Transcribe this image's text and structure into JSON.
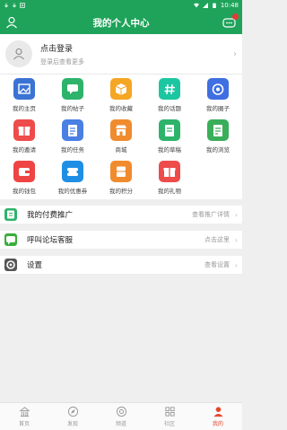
{
  "status_bar": {
    "time": "10:48"
  },
  "header": {
    "title": "我的个人中心"
  },
  "login": {
    "title": "点击登录",
    "subtitle": "登录后查看更多"
  },
  "grid": [
    {
      "label": "我的主页",
      "color": "#3b73d4",
      "icon": "image-icon"
    },
    {
      "label": "我的帖子",
      "color": "#2eb36b",
      "icon": "chat-icon"
    },
    {
      "label": "我的收藏",
      "color": "#f5a623",
      "icon": "cube-icon"
    },
    {
      "label": "我的话题",
      "color": "#1cc6a0",
      "icon": "hashtag-icon"
    },
    {
      "label": "我的圈子",
      "color": "#3f6fe0",
      "icon": "circle-icon"
    },
    {
      "label": "我的邀请",
      "color": "#ee4b4b",
      "icon": "gift-icon"
    },
    {
      "label": "我的任务",
      "color": "#4a7fe3",
      "icon": "task-icon"
    },
    {
      "label": "商城",
      "color": "#f08b2e",
      "icon": "shop-icon"
    },
    {
      "label": "我的草稿",
      "color": "#2eb36b",
      "icon": "draft-icon"
    },
    {
      "label": "我的浏览",
      "color": "#3aae5a",
      "icon": "history-icon"
    },
    {
      "label": "我的钱包",
      "color": "#ee4444",
      "icon": "wallet-icon"
    },
    {
      "label": "我的优惠券",
      "color": "#1f8fe6",
      "icon": "coupon-icon"
    },
    {
      "label": "我的积分",
      "color": "#f08b2e",
      "icon": "points-icon"
    },
    {
      "label": "我的礼物",
      "color": "#ee4b4b",
      "icon": "present-icon"
    }
  ],
  "menu": [
    {
      "label": "我的付费推广",
      "right": "查看推广详情",
      "color": "#2eb36b",
      "icon": "promo-icon"
    },
    {
      "label": "呼叫论坛客服",
      "right": "点击这里",
      "color": "#3aae3a",
      "icon": "service-icon"
    },
    {
      "label": "设置",
      "right": "查看设置",
      "color": "#555555",
      "icon": "gear-icon"
    }
  ],
  "tabs": [
    {
      "label": "首页",
      "icon": "home-icon",
      "active": false
    },
    {
      "label": "发现",
      "icon": "compass-icon",
      "active": false
    },
    {
      "label": "频道",
      "icon": "channel-icon",
      "active": false
    },
    {
      "label": "社区",
      "icon": "community-icon",
      "active": false
    },
    {
      "label": "我的",
      "icon": "profile-icon",
      "active": true
    }
  ]
}
